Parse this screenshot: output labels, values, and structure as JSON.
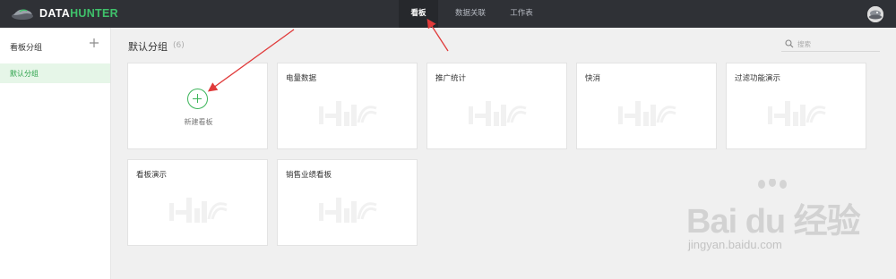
{
  "app": {
    "logo_prefix": "DATA",
    "logo_suffix": "HUNTER",
    "brand_green": "#3fc26b"
  },
  "nav": {
    "tabs": [
      {
        "label": "看板",
        "active": true
      },
      {
        "label": "数据关联",
        "active": false
      },
      {
        "label": "工作表",
        "active": false
      }
    ]
  },
  "sidebar": {
    "title": "看板分组",
    "add_icon": "plus-icon",
    "items": [
      {
        "label": "默认分组",
        "selected": true
      }
    ]
  },
  "main": {
    "group_title": "默认分组",
    "group_count": "(6)",
    "search_placeholder": "搜索",
    "new_card_label": "新建看板",
    "cards": [
      {
        "title": "电量数据"
      },
      {
        "title": "推广统计"
      },
      {
        "title": "快消"
      },
      {
        "title": "过滤功能演示"
      },
      {
        "title": "看板演示"
      },
      {
        "title": "销售业绩看板"
      }
    ]
  },
  "watermark": {
    "brand": "Bai du 经验",
    "url": "jingyan.baidu.com"
  }
}
